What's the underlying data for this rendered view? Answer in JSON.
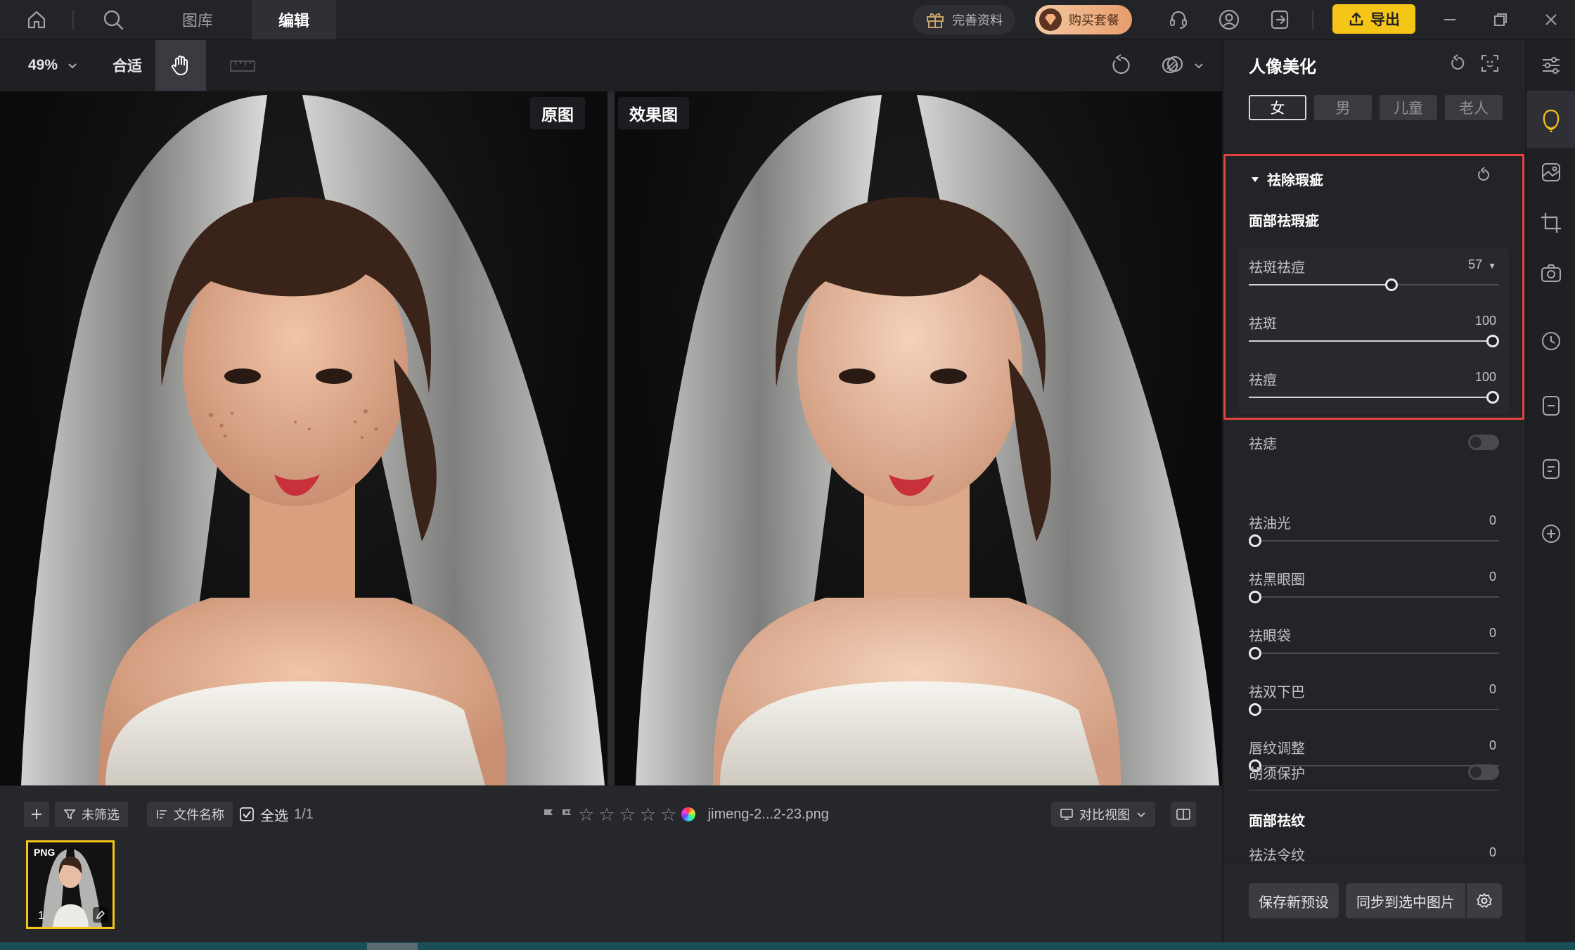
{
  "topbar": {
    "tabs": [
      {
        "label": "图库",
        "active": false
      },
      {
        "label": "编辑",
        "active": true
      }
    ],
    "complete_profile": "完善资料",
    "buy_plan": "购买套餐",
    "export": "导出"
  },
  "toolbar": {
    "zoom": "49%",
    "fit": "合适"
  },
  "canvas": {
    "original_label": "原图",
    "effect_label": "效果图"
  },
  "strip": {
    "filter": "未筛选",
    "sort": "文件名称",
    "select_all": "全选",
    "select_count": "1/1",
    "rating": 0,
    "filename": "jimeng-2...2-23.png",
    "compare_view": "对比视图",
    "thumbnail": {
      "badge": "PNG",
      "index": "1"
    }
  },
  "panel": {
    "title": "人像美化",
    "gender_tabs": [
      {
        "label": "女",
        "active": true
      },
      {
        "label": "男",
        "active": false
      },
      {
        "label": "儿童",
        "active": false
      },
      {
        "label": "老人",
        "active": false
      }
    ],
    "section_title": "祛除瑕疵",
    "subsection_face_blemish": "面部祛瑕疵",
    "sliders": [
      {
        "label": "祛斑祛痘",
        "value": "57",
        "fraction": 0.57,
        "dropdown": true
      },
      {
        "label": "祛斑",
        "value": "100",
        "fraction": 1.0
      },
      {
        "label": "祛痘",
        "value": "100",
        "fraction": 1.0
      }
    ],
    "toggle_mole": {
      "label": "祛痣",
      "on": false
    },
    "sliders2": [
      {
        "label": "祛油光",
        "value": "0",
        "fraction": 0
      },
      {
        "label": "祛黑眼圈",
        "value": "0",
        "fraction": 0
      },
      {
        "label": "祛眼袋",
        "value": "0",
        "fraction": 0
      },
      {
        "label": "祛双下巴",
        "value": "0",
        "fraction": 0
      },
      {
        "label": "唇纹调整",
        "value": "0",
        "fraction": 0
      }
    ],
    "toggle_beard": {
      "label": "胡须保护",
      "on": false
    },
    "subsection_wrinkle": "面部祛纹",
    "nasolabial": {
      "label": "祛法令纹",
      "value": "0"
    },
    "save_preset": "保存新预设",
    "sync_selected": "同步到选中图片"
  },
  "colors": {
    "accent_yellow": "#f5c518",
    "highlight_red": "#e2433a",
    "panel_bg": "#232428"
  }
}
